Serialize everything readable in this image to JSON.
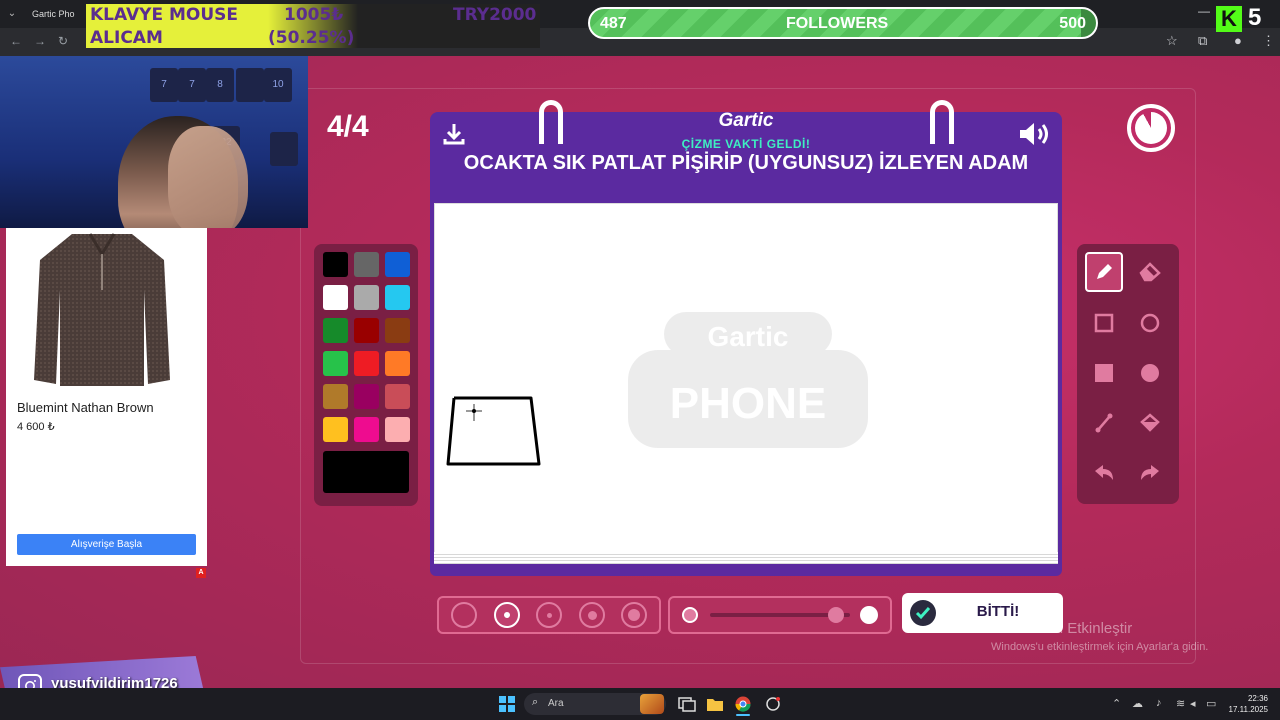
{
  "browser": {
    "tab_title": "Gartic Pho",
    "window_minimize": "—",
    "window_close": "✕"
  },
  "donation": {
    "line1_left": "KLAVYE MOUSE",
    "line2_left": "ALICAM",
    "amount": "1005₺",
    "percent": "(50.25%)",
    "goal": "TRY2000"
  },
  "followers": {
    "current": "487",
    "label": "FOLLOWERS",
    "goal": "500",
    "progress_fraction": 0.974
  },
  "kick": {
    "logo_letter": "K",
    "count": "5"
  },
  "ad": {
    "product_name": "Bluemint Nathan Brown",
    "price": "4 600 ₺",
    "cta": "Alışverişe Başla",
    "badge": "A"
  },
  "game": {
    "round": "4/4",
    "logo": "Gartic",
    "subtitle": "ÇİZME VAKTİ GELDİ!",
    "phrase": "OCAKTA SIK PATLAT PİŞİRİP (UYGUNSUZ) İZLEYEN ADAM",
    "watermark_line1": "Gartic",
    "watermark_line2": "PHONE",
    "done_label": "BİTTİ!",
    "timer_remaining_fraction": 0.92
  },
  "palette": {
    "colors": [
      "#000000",
      "#666666",
      "#0f5fd6",
      "#ffffff",
      "#aaaaaa",
      "#25c8f0",
      "#168a2a",
      "#990000",
      "#8a3c12",
      "#27c24a",
      "#ee1c24",
      "#ff7a26",
      "#b07a2a",
      "#990060",
      "#c94d58",
      "#ffc01f",
      "#ee0c8f",
      "#fcaeb0"
    ],
    "current_color": "#000000"
  },
  "tools": [
    "pencil-tool",
    "eraser-tool",
    "rectangle-outline-tool",
    "ellipse-outline-tool",
    "rectangle-fill-tool",
    "ellipse-fill-tool",
    "line-tool",
    "fill-bucket-tool",
    "undo-tool",
    "redo-tool"
  ],
  "brush_sizes": {
    "count": 5,
    "selected_index": 1
  },
  "opacity": {
    "value_fraction": 0.9
  },
  "windows": {
    "activate_title": "Windows'u Etkinleştir",
    "activate_sub": "Windows'u etkinleştirmek için Ayarlar'a gidin."
  },
  "instagram": {
    "handle": "yusufyildirim1726"
  },
  "taskbar": {
    "search": "Ara",
    "time": "22:36",
    "date": "17.11.2025"
  }
}
